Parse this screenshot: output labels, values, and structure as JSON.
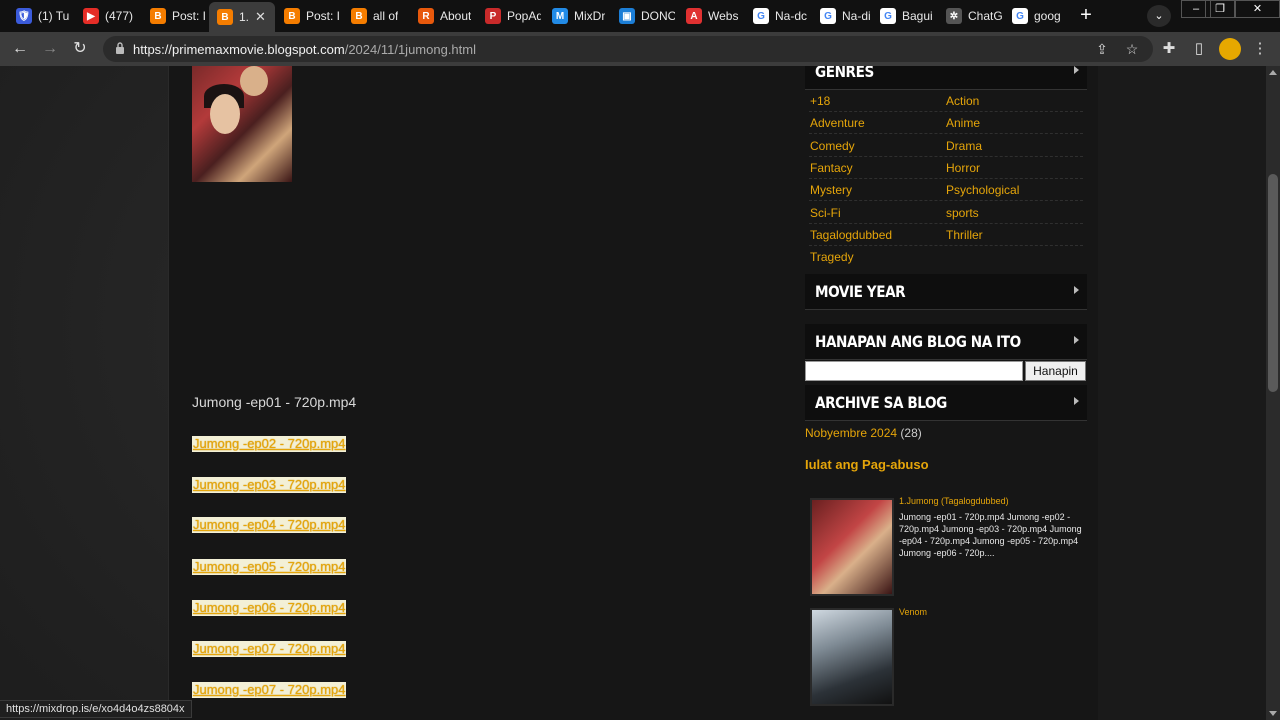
{
  "browser": {
    "tabs": [
      {
        "title": "(1) Tu",
        "favicon": "shield-icon",
        "color": "#3b5bdb",
        "glyph": "🛡"
      },
      {
        "title": "(477)",
        "favicon": "youtube-icon",
        "color": "#e52d27",
        "glyph": "▶"
      },
      {
        "title": "Post: I",
        "favicon": "blogger-icon",
        "color": "#f57d00",
        "glyph": "B"
      },
      {
        "title": "1.",
        "favicon": "blogger-icon",
        "color": "#f57d00",
        "glyph": "B",
        "active": true
      },
      {
        "title": "Post: I",
        "favicon": "blogger-icon",
        "color": "#f57d00",
        "glyph": "B"
      },
      {
        "title": "all of",
        "favicon": "blogger-icon",
        "color": "#f57d00",
        "glyph": "B"
      },
      {
        "title": "About",
        "favicon": "r-logo-icon",
        "color": "#e8590c",
        "glyph": "R"
      },
      {
        "title": "PopAd",
        "favicon": "popads-icon",
        "color": "#c92a2a",
        "glyph": "P"
      },
      {
        "title": "MixDr",
        "favicon": "mixdrop-icon",
        "color": "#228be6",
        "glyph": "M"
      },
      {
        "title": "DONO",
        "favicon": "tv-icon",
        "color": "#1c7ed6",
        "glyph": "▣"
      },
      {
        "title": "Webs",
        "favicon": "a-logo-icon",
        "color": "#e03131",
        "glyph": "A"
      },
      {
        "title": "Na-dc",
        "favicon": "google-icon",
        "color": "#ffffff",
        "glyph": "G"
      },
      {
        "title": "Na-di",
        "favicon": "google-icon",
        "color": "#ffffff",
        "glyph": "G"
      },
      {
        "title": "Bagui",
        "favicon": "google-icon",
        "color": "#ffffff",
        "glyph": "G"
      },
      {
        "title": "ChatG",
        "favicon": "chatgpt-icon",
        "color": "#555555",
        "glyph": "✲"
      },
      {
        "title": "goog",
        "favicon": "google-icon",
        "color": "#ffffff",
        "glyph": "G"
      }
    ],
    "url_host": "https://primemaxmovie.blogspot.com",
    "url_path": "/2024/11/1jumong.html",
    "status_url": "https://mixdrop.is/e/xo4d4o4zs8804x"
  },
  "post": {
    "first_episode": "Jumong -ep01 - 720p.mp4",
    "episode_links": [
      "Jumong -ep02 - 720p.mp4",
      "Jumong -ep03 - 720p.mp4",
      "Jumong -ep04 - 720p.mp4",
      "Jumong -ep05 - 720p.mp4",
      "Jumong -ep06 - 720p.mp4",
      "Jumong -ep07 - 720p.mp4",
      "Jumong -ep07 - 720p.mp4"
    ]
  },
  "sidebar": {
    "genres_title": "GENRES",
    "genres": [
      "+18",
      "Action",
      "Adventure",
      "Anime",
      "Comedy",
      "Drama",
      "Fantacy",
      "Horror",
      "Mystery",
      "Psychological",
      "Sci-Fi",
      "sports",
      "Tagalogdubbed",
      "Thriller",
      "Tragedy"
    ],
    "movie_year_title": "MOVIE YEAR",
    "search_title": "HANAPAN ANG BLOG NA ITO",
    "search_button": "Hanapin",
    "archive_title": "ARCHIVE SA BLOG",
    "archive_month": "Nobyembre 2024",
    "archive_count": "(28)",
    "report_abuse": "Iulat ang Pag-abuso",
    "popular_posts": [
      {
        "title": "1.Jumong (Tagalogdubbed)",
        "snippet": "Jumong -ep01 - 720p.mp4 Jumong -ep02 - 720p.mp4 Jumong -ep03 - 720p.mp4 Jumong -ep04 - 720p.mp4 Jumong -ep05 - 720p.mp4 Jumong -ep06 - 720p...."
      },
      {
        "title": "Venom",
        "snippet": ""
      }
    ]
  },
  "colors": {
    "link": "#e5a50a",
    "link_highlight": "#f3f0d6"
  }
}
